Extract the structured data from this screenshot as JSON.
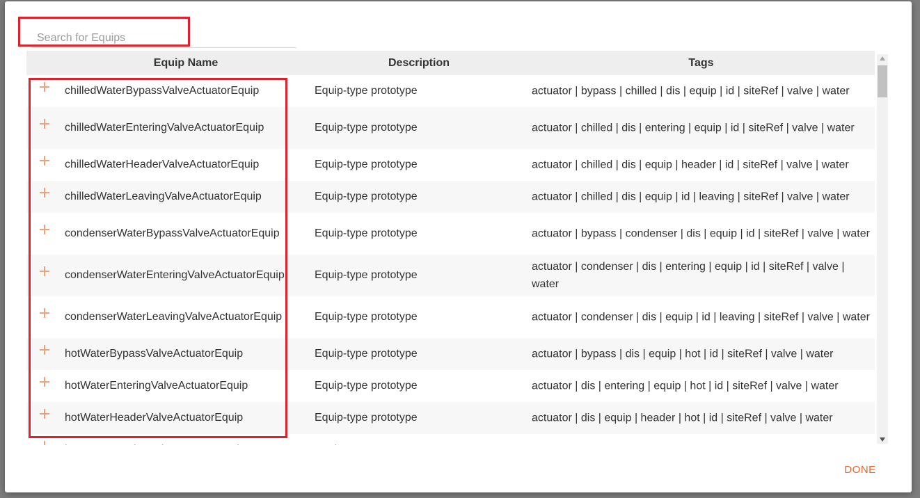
{
  "search": {
    "placeholder": "Search for Equips",
    "value": ""
  },
  "table": {
    "headers": {
      "name": "Equip Name",
      "description": "Description",
      "tags": "Tags"
    },
    "rows": [
      {
        "name": "chilledWaterBypassValveActuatorEquip",
        "description": "Equip-type prototype",
        "tags": "actuator | bypass | chilled | dis | equip | id | siteRef | valve | water"
      },
      {
        "name": "chilledWaterEnteringValveActuatorEquip",
        "description": "Equip-type prototype",
        "tags": "actuator | chilled | dis | entering | equip | id | siteRef | valve | water"
      },
      {
        "name": "chilledWaterHeaderValveActuatorEquip",
        "description": "Equip-type prototype",
        "tags": "actuator | chilled | dis | equip | header | id | siteRef | valve | water"
      },
      {
        "name": "chilledWaterLeavingValveActuatorEquip",
        "description": "Equip-type prototype",
        "tags": "actuator | chilled | dis | equip | id | leaving | siteRef | valve | water"
      },
      {
        "name": "condenserWaterBypassValveActuatorEquip",
        "description": "Equip-type prototype",
        "tags": "actuator | bypass | condenser | dis | equip | id | siteRef | valve | water"
      },
      {
        "name": "condenserWaterEnteringValveActuatorEquip",
        "description": "Equip-type prototype",
        "tags": "actuator | condenser | dis | entering | equip | id | siteRef | valve | water"
      },
      {
        "name": "condenserWaterLeavingValveActuatorEquip",
        "description": "Equip-type prototype",
        "tags": "actuator | condenser | dis | equip | id | leaving | siteRef | valve | water"
      },
      {
        "name": "hotWaterBypassValveActuatorEquip",
        "description": "Equip-type prototype",
        "tags": "actuator | bypass | dis | equip | hot | id | siteRef | valve | water"
      },
      {
        "name": "hotWaterEnteringValveActuatorEquip",
        "description": "Equip-type prototype",
        "tags": "actuator | dis | entering | equip | hot | id | siteRef | valve | water"
      },
      {
        "name": "hotWaterHeaderValveActuatorEquip",
        "description": "Equip-type prototype",
        "tags": "actuator | dis | equip | header | hot | id | siteRef | valve | water"
      },
      {
        "name": "hotWaterLeavingValveActuatorEquip",
        "description": "Equip-type prototype",
        "tags": "actuator | dis | equip | hot | id | leaving | siteRef | valve | water"
      }
    ]
  },
  "footer": {
    "done_label": "DONE"
  },
  "colors": {
    "accent": "#e8642c",
    "plus": "#f3a07a",
    "highlight": "#e0202b",
    "header_bg": "#eeeeee"
  }
}
